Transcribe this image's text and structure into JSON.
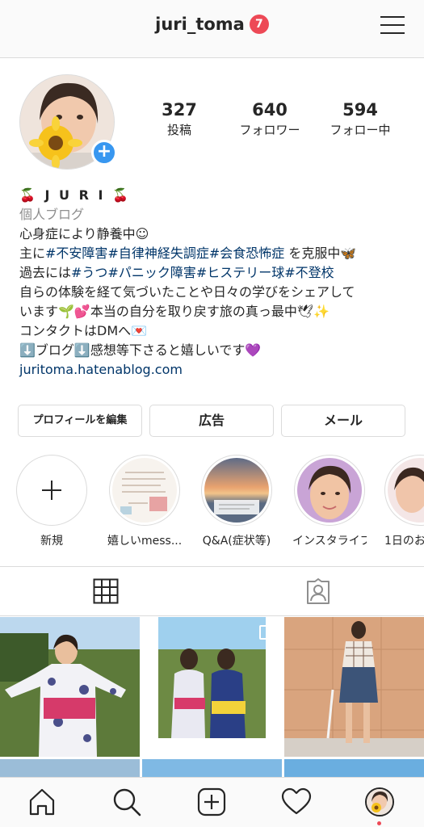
{
  "header": {
    "username": "juri_toma",
    "notification_count": "7"
  },
  "profile": {
    "stats": [
      {
        "value": "327",
        "label": "投稿"
      },
      {
        "value": "640",
        "label": "フォロワー"
      },
      {
        "value": "594",
        "label": "フォロー中"
      }
    ],
    "name": "🍒 J U R I 🍒",
    "category": "個人ブログ",
    "bio": {
      "line1": "心身症により静養中☺︎",
      "line2_prefix": "主に",
      "line2_tags": "#不安障害#自律神経失調症#会食恐怖症",
      "line2_suffix": " を克服中🦋",
      "line3_prefix": "過去には",
      "line3_tags": "#うつ#パニック障害#ヒステリー球#不登校",
      "line4": "自らの体験を経て気づいたことや日々の学びをシェアして",
      "line5": "います🌱💕本当の自分を取り戻す旅の真っ最中🕊✨",
      "line6": "コンタクトはDMへ💌",
      "line7": "⬇️ブログ⬇️感想等下さると嬉しいです💜"
    },
    "website": "juritoma.hatenablog.com"
  },
  "actions": {
    "edit_profile": "プロフィールを編集",
    "promotions": "広告",
    "email": "メール"
  },
  "highlights": [
    {
      "label": "新規",
      "icon": "plus-icon"
    },
    {
      "label": "嬉しいmess..."
    },
    {
      "label": "Q&A(症状等)"
    },
    {
      "label": "インスタライブ"
    },
    {
      "label": "1日のお"
    }
  ],
  "tabs": [
    {
      "name": "grid",
      "icon": "grid-icon",
      "active": true
    },
    {
      "name": "tagged",
      "icon": "tagged-icon",
      "active": false
    }
  ],
  "bottom_nav": [
    {
      "icon": "home-icon"
    },
    {
      "icon": "search-icon"
    },
    {
      "icon": "add-post-icon"
    },
    {
      "icon": "heart-icon"
    },
    {
      "icon": "profile-avatar"
    }
  ],
  "colors": {
    "link": "#003569",
    "accent_blue": "#3897f0",
    "badge_red": "#ed4956",
    "border": "#dbdbdb"
  }
}
